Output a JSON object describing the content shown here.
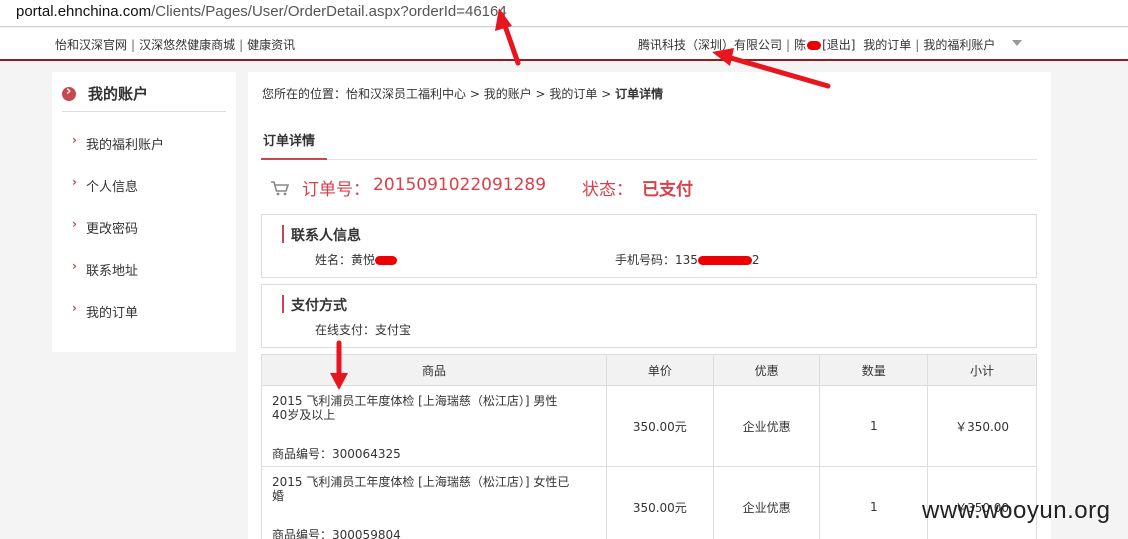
{
  "browser": {
    "url_host": "portal.ehnchina.com",
    "url_path": "/Clients/Pages/User/OrderDetail.aspx?orderId=46164"
  },
  "topnav": {
    "left_links": [
      "怡和汉深官网",
      "汉深悠然健康商城",
      "健康资讯"
    ],
    "company": "腾讯科技（深圳）有限公司",
    "user_prefix": "陈",
    "logout": "[退出]",
    "my_orders": "我的订单",
    "my_account": "我的福利账户"
  },
  "sidebar": {
    "title": "我的账户",
    "items": [
      "我的福利账户",
      "个人信息",
      "更改密码",
      "联系地址",
      "我的订单"
    ]
  },
  "breadcrumb": {
    "prefix": "您所在的位置：",
    "path": "怡和汉深员工福利中心 > 我的账户 > 我的订单 >",
    "current": "订单详情"
  },
  "tab": "订单详情",
  "order": {
    "number_label": "订单号：",
    "number": "2015091022091289",
    "status_label": "状态：",
    "status": "已支付"
  },
  "contact": {
    "title": "联系人信息",
    "name_label": "姓名：",
    "name": "黄悦",
    "phone_label": "手机号码：",
    "phone_prefix": "135",
    "phone_suffix": "2"
  },
  "payment": {
    "title": "支付方式",
    "label": "在线支付：",
    "value": "支付宝"
  },
  "table": {
    "headers": [
      "商品",
      "单价",
      "优惠",
      "数量",
      "小计"
    ],
    "rows": [
      {
        "name": "2015 飞利浦员工年度体检 [上海瑞慈（松江店）] 男性40岁及以上",
        "code_label": "商品编号：",
        "code": "300064325",
        "price": "350.00元",
        "discount": "企业优惠",
        "qty": "1",
        "subtotal": "￥350.00"
      },
      {
        "name": "2015 飞利浦员工年度体检 [上海瑞慈（松江店）] 女性已婚",
        "code_label": "商品编号：",
        "code": "300059804",
        "price": "350.00元",
        "discount": "企业优惠",
        "qty": "1",
        "subtotal": "￥350.00"
      }
    ]
  },
  "watermark": "www.wooyun.org",
  "colors": {
    "accent": "#c8484f",
    "nav_border": "#8f1d22",
    "annotation": "#e8141e"
  },
  "icons": [
    "cart-icon",
    "arrow-circle-icon",
    "chevron-down-icon"
  ]
}
